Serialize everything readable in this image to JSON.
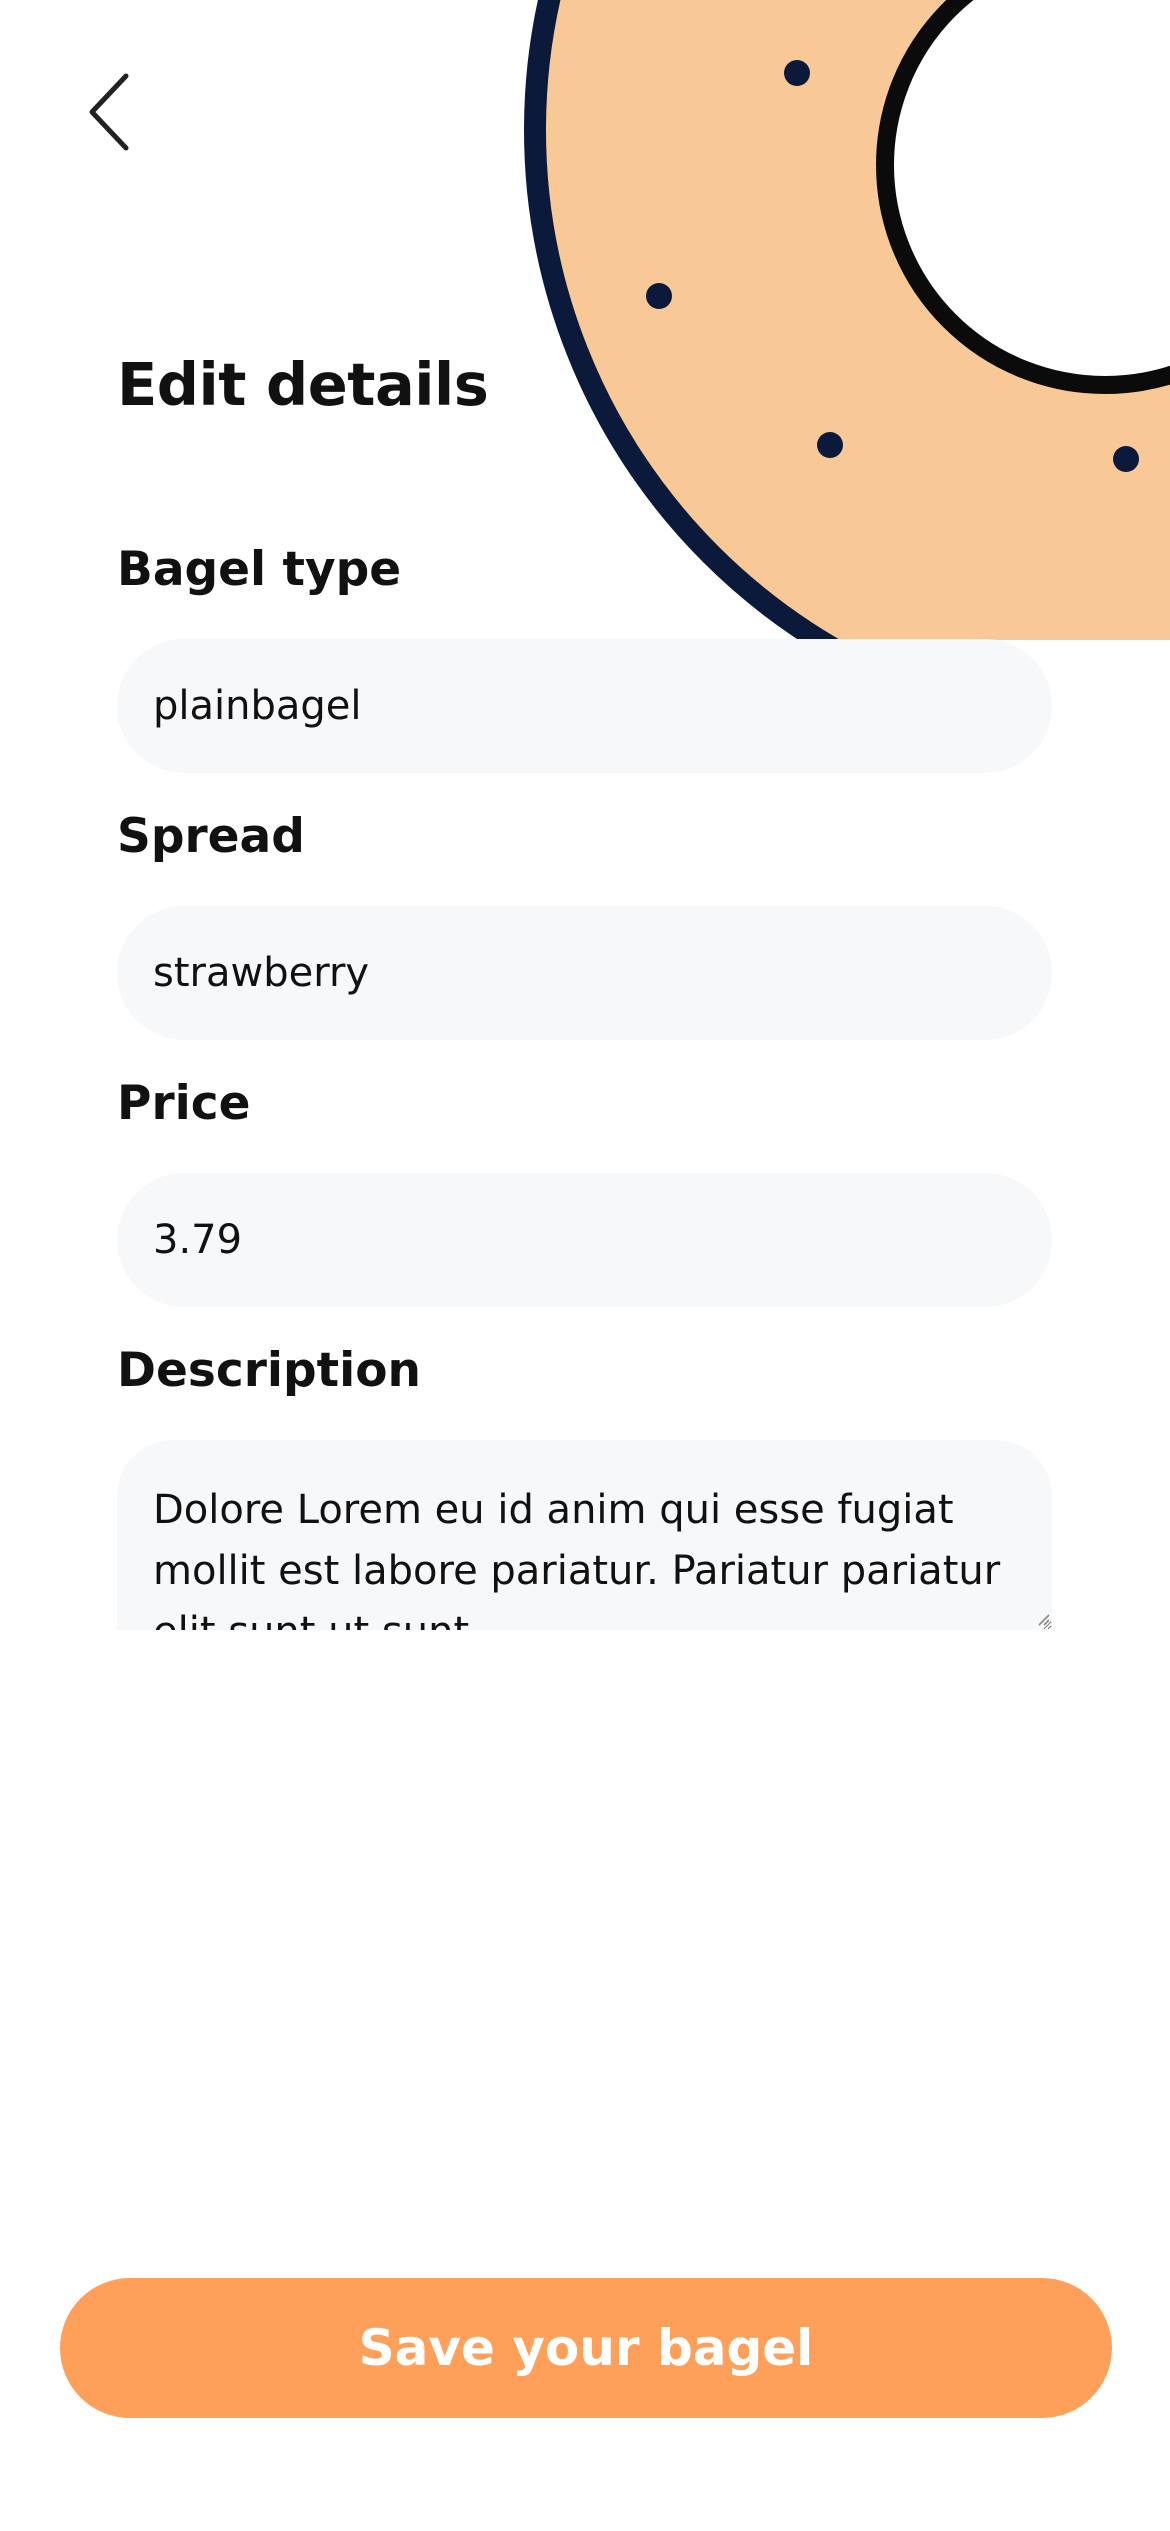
{
  "header": {
    "back_icon": "chevron-left-icon",
    "illustration": "bagel-illustration"
  },
  "page": {
    "title": "Edit details"
  },
  "form": {
    "bagel_type": {
      "label": "Bagel type",
      "value": "plainbagel"
    },
    "spread": {
      "label": "Spread",
      "value": "strawberry"
    },
    "price": {
      "label": "Price",
      "value": "3.79"
    },
    "description": {
      "label": "Description",
      "value": "Dolore Lorem eu id anim qui esse fugiat mollit est labore pariatur. Pariatur pariatur elit sunt ut sunt"
    }
  },
  "actions": {
    "save_label": "Save your bagel"
  },
  "colors": {
    "accent": "#ffa05a",
    "bagel_fill": "#f8c996",
    "bagel_outline": "#0b1a3a",
    "input_background": "#f7f8fa"
  }
}
